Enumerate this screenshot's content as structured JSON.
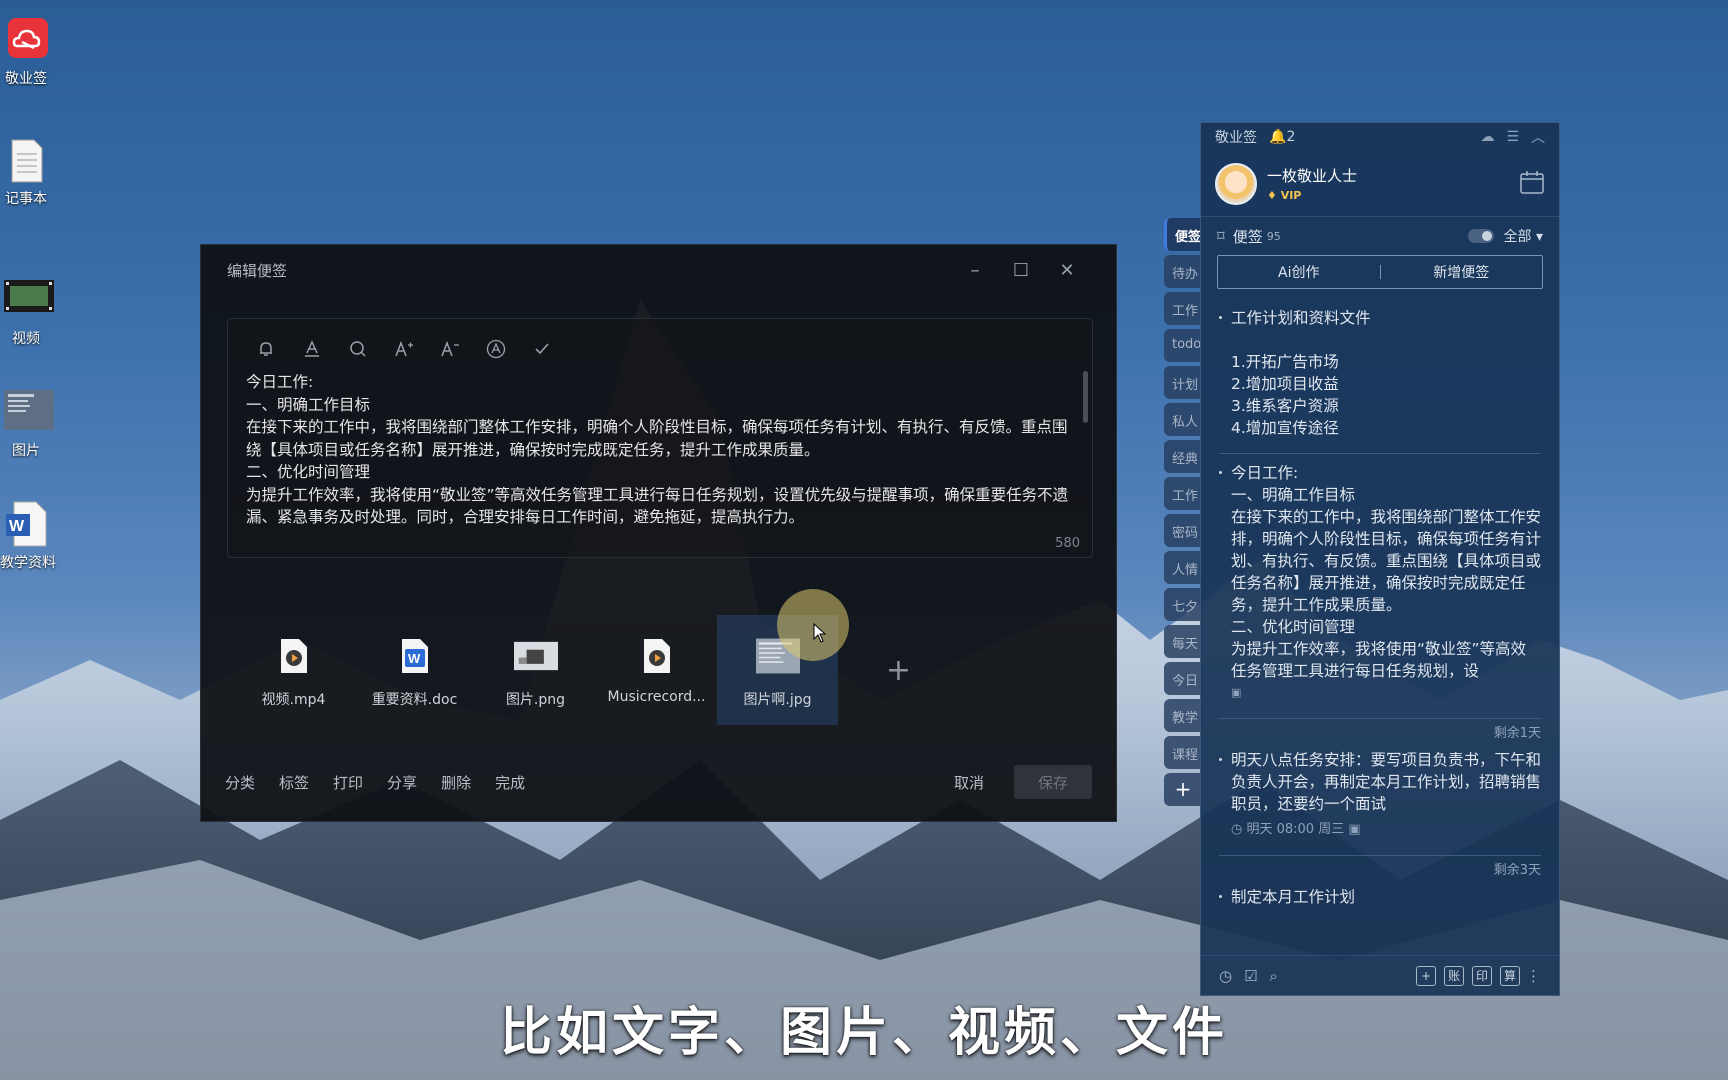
{
  "desktop": {
    "icons": [
      {
        "label": "敬业签"
      },
      {
        "label": "记事本"
      },
      {
        "label": "视频"
      },
      {
        "label": "图片"
      },
      {
        "label": "教学资料"
      }
    ]
  },
  "editor": {
    "title": "编辑便签",
    "body": [
      "今日工作:",
      "一、明确工作目标",
      "在接下来的工作中，我将围绕部门整体工作安排，明确个人阶段性目标，确保每项任务有计划、有执行、有反馈。重点围绕【具体项目或任务名称】展开推进，确保按时完成既定任务，提升工作成果质量。",
      "二、优化时间管理",
      "为提升工作效率，我将使用“敬业签”等高效任务管理工具进行每日任务规划，设置优先级与提醒事项，确保重要任务不遗漏、紧急事务及时处理。同时，合理安排每日工作时间，避免拖延，提高执行力。"
    ],
    "char_count": "580",
    "attachments": [
      {
        "name": "视频.mp4"
      },
      {
        "name": "重要资料.doc"
      },
      {
        "name": "图片.png"
      },
      {
        "name": "Musicrecord..."
      },
      {
        "name": "图片啊.jpg"
      }
    ],
    "add_symbol": "+",
    "actions": [
      "分类",
      "标签",
      "打印",
      "分享",
      "删除",
      "完成"
    ],
    "cancel": "取消",
    "save": "保存"
  },
  "tabs": [
    "便签",
    "待办",
    "工作",
    "todo",
    "计划",
    "私人",
    "经典",
    "工作",
    "密码",
    "人情",
    "七夕",
    "每天",
    "今日",
    "教学",
    "课程"
  ],
  "tab_add": "+",
  "panel": {
    "app_name": "敬业签",
    "notification_count": "2",
    "username": "一枚敬业人士",
    "vip": "VIP",
    "section_title": "便签",
    "section_count": "95",
    "filter": "全部",
    "ai_button": "Ai创作",
    "new_button": "新增便签",
    "notes": {
      "n1_title": "工作计划和资料文件",
      "n1_lines": [
        "1.开拓广告市场",
        "2.增加项目收益",
        "3.维系客户资源",
        "4.增加宣传途径"
      ],
      "n2_lines": [
        "今日工作:",
        "一、明确工作目标",
        "在接下来的工作中，我将围绕部门整体工作安排，明确个人阶段性目标，确保每项任务有计划、有执行、有反馈。重点围绕【具体项目或任务名称】展开推进，确保按时完成既定任务，提升工作成果质量。",
        "二、优化时间管理",
        "为提升工作效率，我将使用“敬业签”等高效任务管理工具进行每日任务规划，设"
      ],
      "n3_remain": "剩余1天",
      "n3_text": "明天八点任务安排：要写项目负责书，下午和负责人开会，再制定本月工作计划，招聘销售职员，还要约一个面试",
      "n3_meta": "明天 08:00 周三",
      "n4_remain": "剩余3天",
      "n4_text": "制定本月工作计划"
    },
    "bottom_buttons": [
      "账",
      "印",
      "算"
    ]
  },
  "caption": "比如文字、图片、视频、文件"
}
